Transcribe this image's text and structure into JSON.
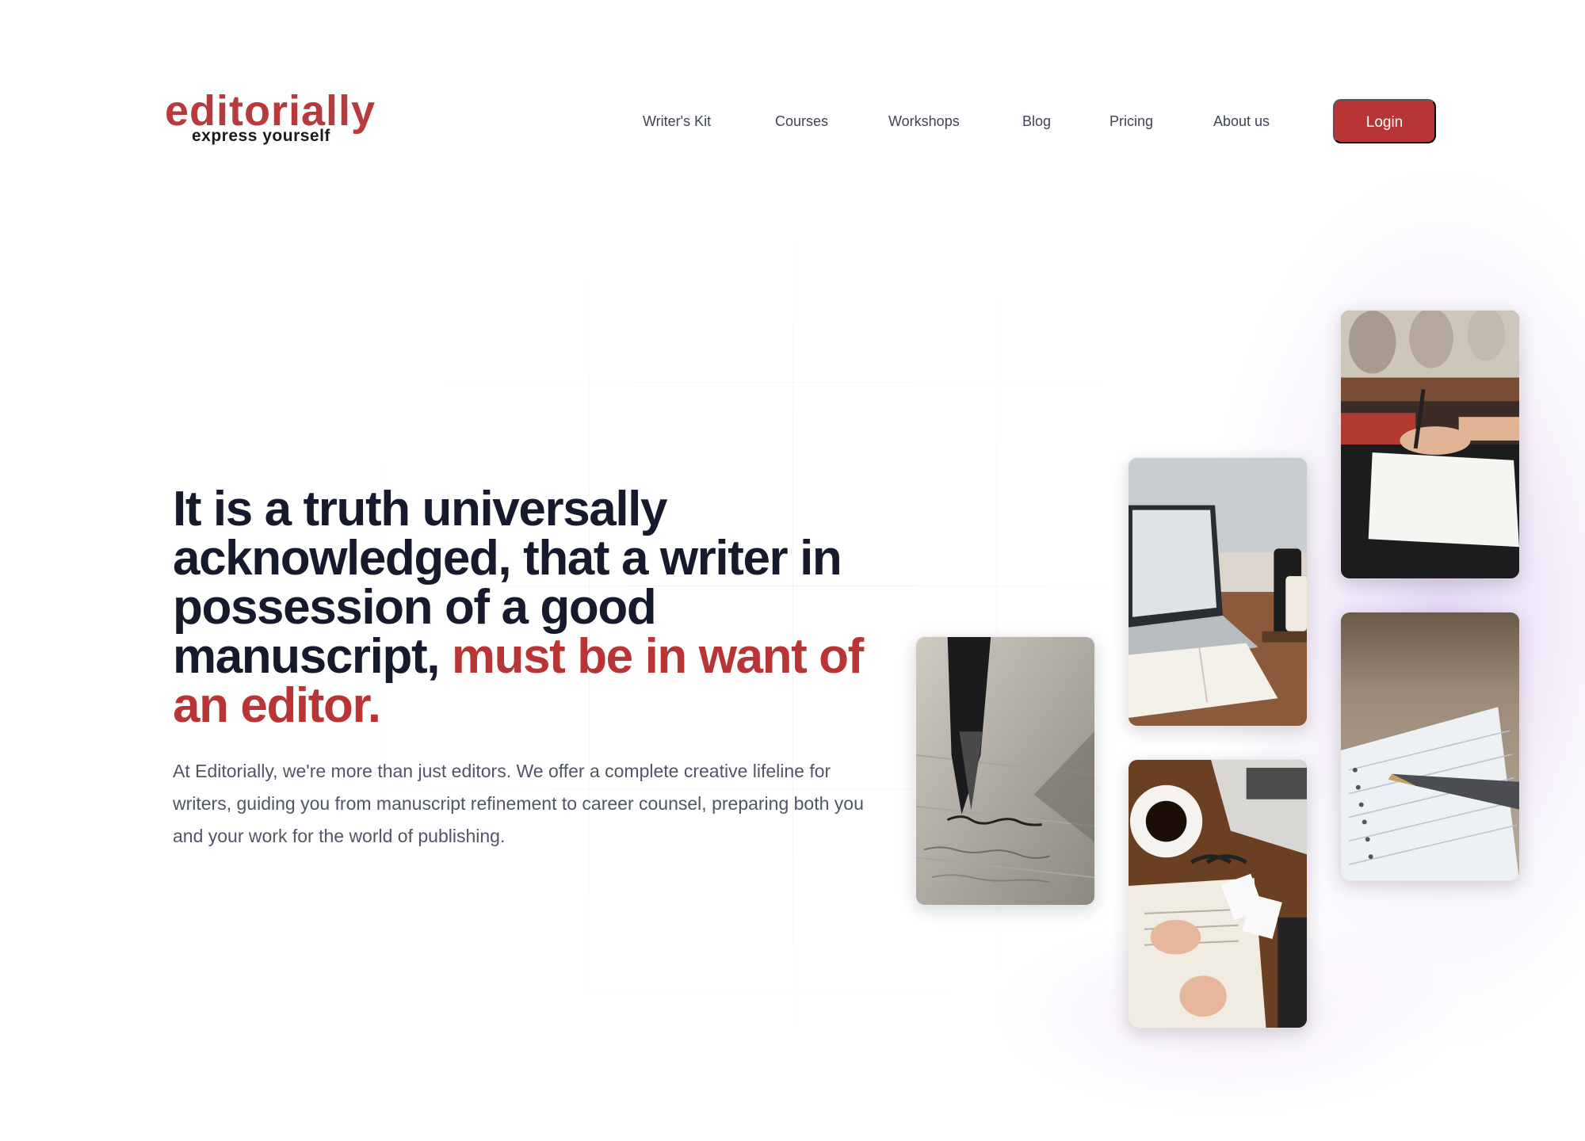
{
  "brand": {
    "name": "editorially",
    "tagline": "express yourself"
  },
  "nav": {
    "items": [
      "Writer's Kit",
      "Courses",
      "Workshops",
      "Blog",
      "Pricing",
      "About us"
    ],
    "login_label": "Login"
  },
  "hero": {
    "headline_main": "It is a truth universally acknowledged, that a writer in possession of a good manuscript,",
    "headline_accent": "must be in want of an editor.",
    "body": "At Editorially, we're more than just editors. We offer a complete creative lifeline for writers, guiding you from manuscript refinement to career counsel, preparing both you and your work for the world of publishing."
  },
  "gallery": {
    "photos": [
      "fountain-pen-writing-photo",
      "laptop-notebook-desk-photo",
      "coffee-journal-desk-photo",
      "hand-writing-notebook-photo",
      "pen-on-spiral-notebook-photo"
    ]
  },
  "colors": {
    "brand_red": "#b93535",
    "heading_navy": "#161a2c",
    "body_gray": "#4f5666",
    "nav_gray": "#3f4452"
  }
}
